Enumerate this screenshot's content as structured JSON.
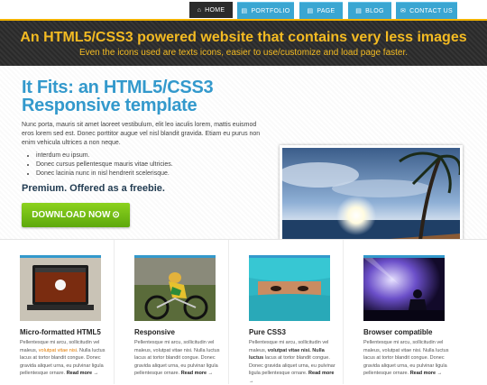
{
  "nav": {
    "items": [
      {
        "label": "HOME",
        "icon": "home-icon",
        "glyph": "⌂"
      },
      {
        "label": "PORTFOLIO",
        "icon": "document-icon",
        "glyph": "▤"
      },
      {
        "label": "PAGE",
        "icon": "document-icon",
        "glyph": "▤"
      },
      {
        "label": "BLOG",
        "icon": "document-icon",
        "glyph": "▤"
      },
      {
        "label": "CONTACT US",
        "icon": "mail-icon",
        "glyph": "✉"
      }
    ]
  },
  "banner": {
    "title": "An HTML5/CSS3 powered website that contains very less images",
    "subtitle": "Even the icons used are texts icons, easier to use/customize and load page faster."
  },
  "hero": {
    "title": "It Fits: an HTML5/CSS3 Responsive template",
    "paragraph": "Nunc porta, mauris sit amet laoreet vestibulum, elit leo iaculis lorem, mattis euismod eros lorem sed est. Donec porttitor augue vel nisl blandit gravida. Etiam eu purus non enim vehicula ultrices a non neque.",
    "bullets": [
      "interdum eu ipsum.",
      "Donec cursus pellentesque mauris vitae ultricies.",
      "Donec lacinia nunc in nisl hendrerit scelerisque."
    ],
    "tagline": "Premium. Offered as a freebie.",
    "download_label": "DOWNLOAD NOW",
    "download_icon": "⊙"
  },
  "columns": [
    {
      "title": "Micro-formatted HTML5",
      "text_a": "Pellentesque mi arcu, sollicitudin vel maleus, ",
      "text_b": "volutpat vitae nisi",
      "text_c": ". Nulla luctus lacus at tortor blandit congue. Donec gravida aliquet urna, eu pulvinar ligula pellentesque ornare. ",
      "read_more": "Read more →"
    },
    {
      "title": "Responsive",
      "text_a": "Pellentesque mi arcu, sollicitudin vel maleus, volutpat vitae nisi. Nulla luctus lacus at tortor blandit congue. Donec gravida aliquet urna, eu pulvinar ligula pellentesque ornare. ",
      "text_b": "",
      "text_c": "",
      "read_more": "Read more →"
    },
    {
      "title": "Pure CSS3",
      "text_a": "Pellentesque mi arcu, sollicitudin vel maleus, ",
      "text_b": "volutpat vitae nisi. Nulla luctus",
      "text_c": " lacus at tortor blandit congue. Donec gravida aliquet urna, eu pulvinar ligula pellentesque ornare. ",
      "read_more": "Read more →"
    },
    {
      "title": "Browser compatible",
      "text_a": "Pellentesque mi arcu, sollicitudin vel maleus, volutpat vitae nisi. Nulla luctus lacus at tortor blandit congue. Donec gravida aliquet urna, eu pulvinar ligula pellentesque ornare. ",
      "text_b": "",
      "text_c": "",
      "read_more": "Read more →"
    }
  ],
  "colors": {
    "accent_blue": "#3399cc",
    "banner_yellow": "#f4bb22",
    "download_green": "#6bbb12"
  }
}
